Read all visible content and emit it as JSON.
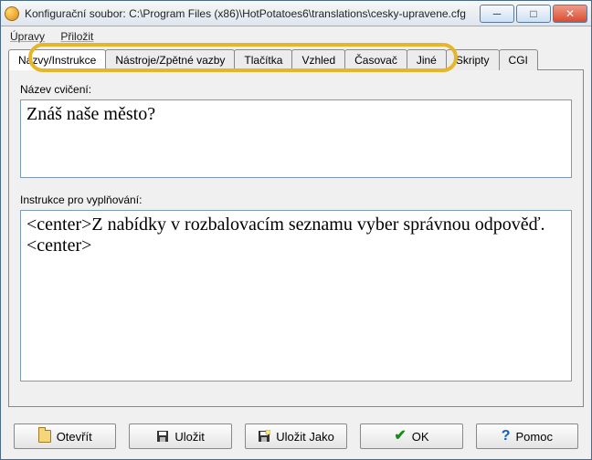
{
  "window": {
    "title": "Konfigurační soubor: C:\\Program Files (x86)\\HotPotatoes6\\translations\\cesky-upravene.cfg"
  },
  "menu": {
    "edit": "Úpravy",
    "insert": "Přiložit"
  },
  "tabs": {
    "t0": "Názvy/Instrukce",
    "t1": "Nástroje/Zpětné vazby",
    "t2": "Tlačítka",
    "t3": "Vzhled",
    "t4": "Časovač",
    "t5": "Jiné",
    "t6": "Skripty",
    "t7": "CGI"
  },
  "labels": {
    "exercise_title": "Název cvičení:",
    "instructions": "Instrukce pro vyplňování:"
  },
  "fields": {
    "exercise_title_value": "Znáš naše město?",
    "instructions_value": "<center>Z nabídky v rozbalovacím seznamu vyber správnou odpověď.<center>"
  },
  "buttons": {
    "open": "Otevřít",
    "save": "Uložit",
    "save_as": "Uložit Jako",
    "ok": "OK",
    "help": "Pomoc"
  }
}
